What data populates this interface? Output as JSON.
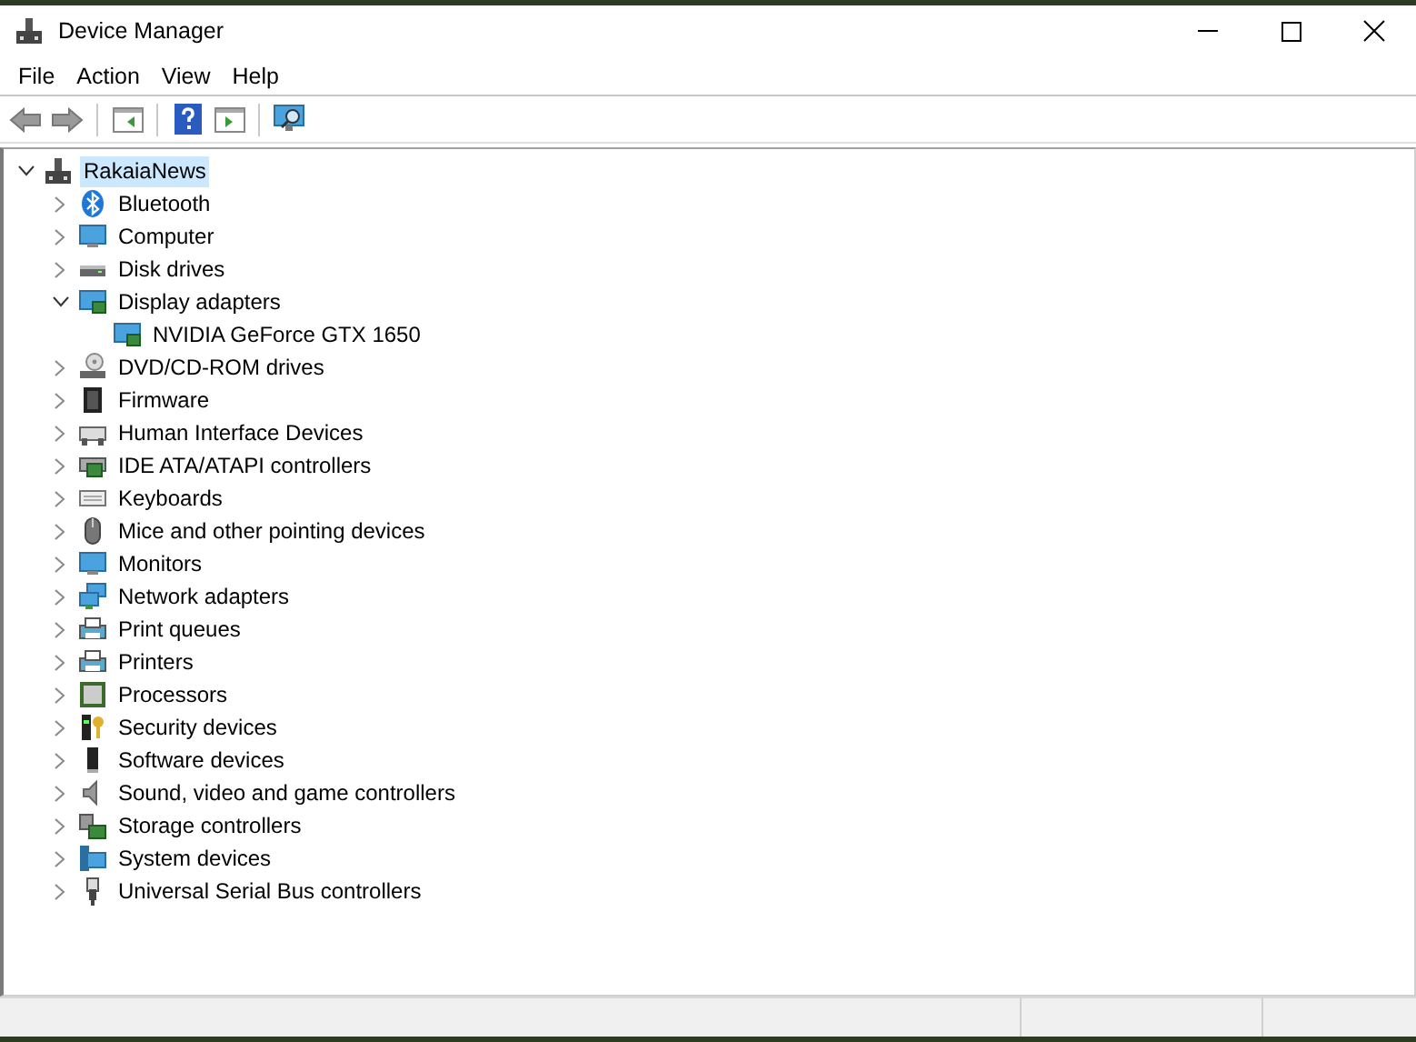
{
  "window": {
    "title": "Device Manager"
  },
  "menu": [
    "File",
    "Action",
    "View",
    "Help"
  ],
  "tree": {
    "label": "RakaiaNews",
    "expanded": true,
    "selected": true,
    "children": [
      {
        "label": "Bluetooth",
        "expanded": false
      },
      {
        "label": "Computer",
        "expanded": false
      },
      {
        "label": "Disk drives",
        "expanded": false
      },
      {
        "label": "Display adapters",
        "expanded": true,
        "children": [
          {
            "label": "NVIDIA GeForce GTX 1650"
          }
        ]
      },
      {
        "label": "DVD/CD-ROM drives",
        "expanded": false
      },
      {
        "label": "Firmware",
        "expanded": false
      },
      {
        "label": "Human Interface Devices",
        "expanded": false
      },
      {
        "label": "IDE ATA/ATAPI controllers",
        "expanded": false
      },
      {
        "label": "Keyboards",
        "expanded": false
      },
      {
        "label": "Mice and other pointing devices",
        "expanded": false
      },
      {
        "label": "Monitors",
        "expanded": false
      },
      {
        "label": "Network adapters",
        "expanded": false
      },
      {
        "label": "Print queues",
        "expanded": false
      },
      {
        "label": "Printers",
        "expanded": false
      },
      {
        "label": "Processors",
        "expanded": false
      },
      {
        "label": "Security devices",
        "expanded": false
      },
      {
        "label": "Software devices",
        "expanded": false
      },
      {
        "label": "Sound, video and game controllers",
        "expanded": false
      },
      {
        "label": "Storage controllers",
        "expanded": false
      },
      {
        "label": "System devices",
        "expanded": false
      },
      {
        "label": "Universal Serial Bus controllers",
        "expanded": false
      }
    ]
  }
}
